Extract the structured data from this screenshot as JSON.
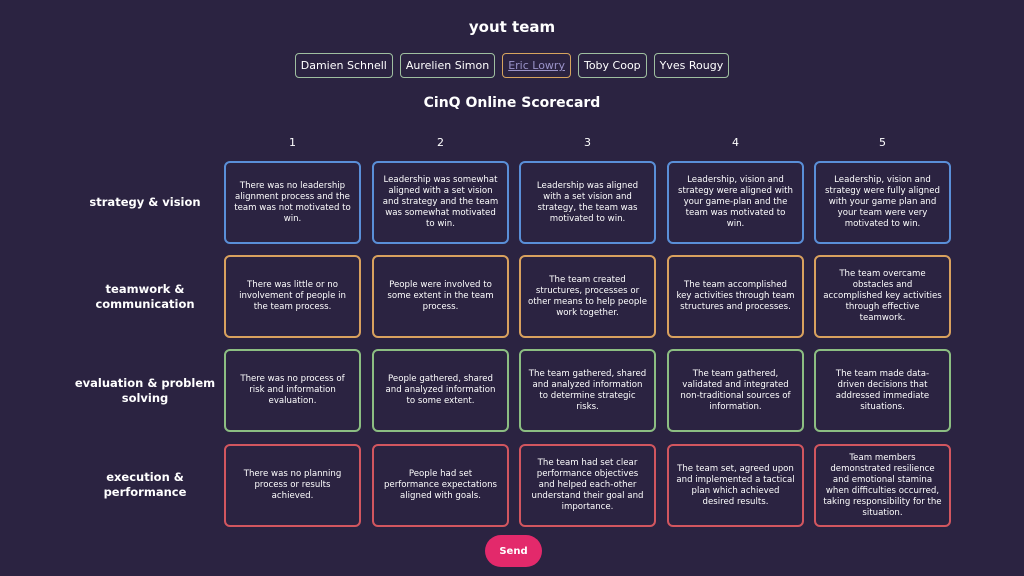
{
  "team_title": "yout team",
  "members": [
    "Damien Schnell",
    "Aurelien Simon",
    "Eric Lowry",
    "Toby Coop",
    "Yves Rougy"
  ],
  "selected_member": "Eric Lowry",
  "scorecard_title": "CinQ Online Scorecard",
  "columns": [
    "1",
    "2",
    "3",
    "4",
    "5"
  ],
  "rows": [
    {
      "label": "strategy & vision",
      "color": "#5a8fd8",
      "cells": [
        "There was no leadership alignment process and the team was not motivated to win.",
        "Leadership was somewhat aligned with a set vision and strategy and the team was somewhat motivated to win.",
        "Leadership was aligned with a set vision and strategy, the team was motivated to win.",
        "Leadership, vision and strategy were aligned with your game-plan and the team was motivated to win.",
        "Leadership, vision and strategy were fully aligned with your game plan and your team were very motivated to win."
      ]
    },
    {
      "label": "teamwork & communication",
      "color": "#d9a15e",
      "cells": [
        "There was little or no involvement of people in the team process.",
        "People were involved to some extent in the team process.",
        "The team created structures, processes or other means to help people work together.",
        "The team accomplished key activities through team structures and processes.",
        "The team overcame obstacles and accomplished key activities through effective teamwork."
      ]
    },
    {
      "label": "evaluation & problem solving",
      "color": "#8cbe82",
      "cells": [
        "There was no process of risk and information evaluation.",
        "People gathered, shared and analyzed information to some extent.",
        "The team gathered, shared and analyzed information to determine strategic risks.",
        "The team gathered, validated and integrated non-traditional sources of information.",
        "The team made data-driven decisions that addressed immediate situations."
      ]
    },
    {
      "label": "execution & performance",
      "color": "#d2565f",
      "cells": [
        "There was no planning process or results achieved.",
        "People had set performance expectations aligned with goals.",
        "The team had set clear performance objectives and helped each-other understand their goal and importance.",
        "The team set, agreed upon and implemented a tactical plan which achieved desired results.",
        "Team members demonstrated resilience and emotional stamina when difficulties occurred, taking responsibility for the situation."
      ]
    }
  ],
  "send_label": "Send"
}
